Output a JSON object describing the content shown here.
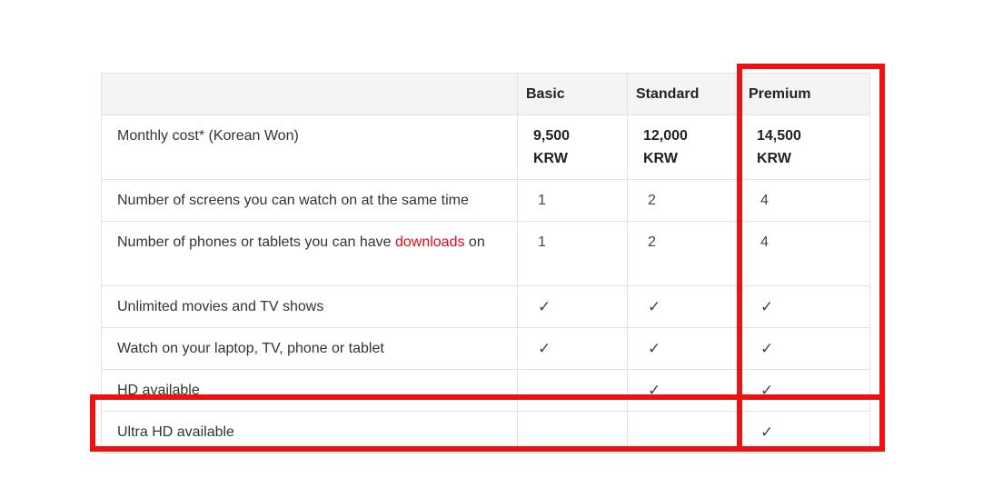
{
  "table": {
    "headers": {
      "feature": "",
      "basic": "Basic",
      "standard": "Standard",
      "premium": "Premium"
    },
    "rows": {
      "monthly_cost": {
        "label": "Monthly cost* (Korean Won)",
        "basic_amount": "9,500",
        "basic_currency": "KRW",
        "standard_amount": "12,000",
        "standard_currency": "KRW",
        "premium_amount": "14,500",
        "premium_currency": "KRW"
      },
      "screens": {
        "label": "Number of screens you can watch on at the same time",
        "basic": "1",
        "standard": "2",
        "premium": "4"
      },
      "downloads": {
        "label_before": "Number of phones or tablets you can have ",
        "label_link": "downloads",
        "label_after": " on",
        "basic": "1",
        "standard": "2",
        "premium": "4"
      },
      "unlimited": {
        "label": "Unlimited movies and TV shows",
        "basic": "✓",
        "standard": "✓",
        "premium": "✓"
      },
      "devices": {
        "label": "Watch on your laptop, TV, phone or tablet",
        "basic": "✓",
        "standard": "✓",
        "premium": "✓"
      },
      "hd": {
        "label": "HD available",
        "basic": "",
        "standard": "✓",
        "premium": "✓"
      },
      "ultra_hd": {
        "label": "Ultra HD available",
        "basic": "",
        "standard": "",
        "premium": "✓"
      }
    }
  },
  "colors": {
    "highlight": "#ee1111",
    "link": "#e50914",
    "header_bg": "#f4f4f2"
  }
}
